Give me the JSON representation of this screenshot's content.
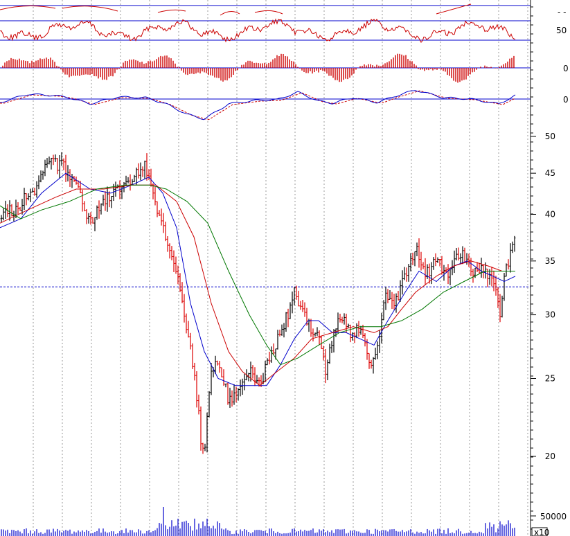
{
  "chart_data": {
    "type": "candlestick",
    "title": "",
    "xlabel": "",
    "ylabel": "",
    "price_axis": {
      "scale": "log",
      "ylim": [
        17.5,
        50.5
      ],
      "tick_labels": [
        "50",
        "45",
        "40",
        "35",
        "30",
        "25",
        "20"
      ],
      "reference_level": 32.5,
      "grid": "vertical dotted"
    },
    "price_path": [
      [
        0,
        39.5
      ],
      [
        10,
        40.5
      ],
      [
        25,
        40.5
      ],
      [
        35,
        42.0
      ],
      [
        55,
        43.5
      ],
      [
        70,
        46.5
      ],
      [
        90,
        46.0
      ],
      [
        110,
        43.5
      ],
      [
        130,
        39.0
      ],
      [
        150,
        41.5
      ],
      [
        170,
        43.0
      ],
      [
        190,
        44.5
      ],
      [
        210,
        46.0
      ],
      [
        225,
        41.0
      ],
      [
        240,
        37.0
      ],
      [
        255,
        34.0
      ],
      [
        265,
        30.5
      ],
      [
        275,
        27.0
      ],
      [
        285,
        23.5
      ],
      [
        292,
        20.0
      ],
      [
        297,
        21.0
      ],
      [
        305,
        25.5
      ],
      [
        315,
        26.5
      ],
      [
        330,
        23.5
      ],
      [
        345,
        24.0
      ],
      [
        360,
        25.5
      ],
      [
        375,
        24.5
      ],
      [
        390,
        26.5
      ],
      [
        405,
        28.5
      ],
      [
        415,
        30.0
      ],
      [
        425,
        32.0
      ],
      [
        432,
        31.0
      ],
      [
        445,
        29.0
      ],
      [
        460,
        28.5
      ],
      [
        470,
        25.5
      ],
      [
        480,
        28.0
      ],
      [
        490,
        30.0
      ],
      [
        505,
        28.5
      ],
      [
        520,
        29.0
      ],
      [
        535,
        25.5
      ],
      [
        545,
        27.0
      ],
      [
        555,
        32.0
      ],
      [
        570,
        31.0
      ],
      [
        585,
        33.5
      ],
      [
        600,
        36.5
      ],
      [
        615,
        33.5
      ],
      [
        630,
        35.5
      ],
      [
        645,
        33.5
      ],
      [
        660,
        35.5
      ],
      [
        670,
        35.5
      ],
      [
        685,
        34.0
      ],
      [
        700,
        34.0
      ],
      [
        712,
        33.0
      ],
      [
        722,
        30.0
      ],
      [
        730,
        34.0
      ],
      [
        738,
        36.0
      ],
      [
        744,
        37.5
      ]
    ],
    "moving_averages": [
      {
        "color": "#0000cc",
        "values": [
          [
            0,
            38.5
          ],
          [
            30,
            39.5
          ],
          [
            60,
            42.5
          ],
          [
            95,
            45.0
          ],
          [
            130,
            43.0
          ],
          [
            160,
            42.5
          ],
          [
            190,
            43.5
          ],
          [
            215,
            44.5
          ],
          [
            235,
            42.5
          ],
          [
            255,
            38.5
          ],
          [
            275,
            31.0
          ],
          [
            295,
            27.0
          ],
          [
            315,
            25.0
          ],
          [
            340,
            24.5
          ],
          [
            365,
            24.5
          ],
          [
            385,
            24.5
          ],
          [
            405,
            26.0
          ],
          [
            425,
            28.0
          ],
          [
            445,
            29.5
          ],
          [
            460,
            29.5
          ],
          [
            480,
            28.5
          ],
          [
            500,
            28.5
          ],
          [
            520,
            28.0
          ],
          [
            540,
            27.5
          ],
          [
            560,
            29.5
          ],
          [
            585,
            32.0
          ],
          [
            605,
            34.0
          ],
          [
            630,
            33.0
          ],
          [
            655,
            34.5
          ],
          [
            675,
            35.0
          ],
          [
            695,
            34.0
          ],
          [
            712,
            33.5
          ],
          [
            728,
            33.0
          ],
          [
            744,
            33.5
          ]
        ]
      },
      {
        "color": "#cc0000",
        "values": [
          [
            0,
            39.0
          ],
          [
            40,
            40.5
          ],
          [
            80,
            42.0
          ],
          [
            110,
            43.0
          ],
          [
            150,
            43.0
          ],
          [
            190,
            43.5
          ],
          [
            225,
            43.5
          ],
          [
            255,
            41.5
          ],
          [
            280,
            37.5
          ],
          [
            305,
            31.0
          ],
          [
            330,
            27.0
          ],
          [
            350,
            25.5
          ],
          [
            375,
            24.5
          ],
          [
            400,
            25.5
          ],
          [
            425,
            26.5
          ],
          [
            450,
            28.0
          ],
          [
            480,
            28.5
          ],
          [
            510,
            29.0
          ],
          [
            540,
            28.5
          ],
          [
            560,
            29.0
          ],
          [
            580,
            30.5
          ],
          [
            600,
            32.0
          ],
          [
            630,
            33.5
          ],
          [
            655,
            34.5
          ],
          [
            680,
            35.0
          ],
          [
            705,
            34.5
          ],
          [
            725,
            34.0
          ],
          [
            744,
            34.0
          ]
        ]
      },
      {
        "color": "#007700",
        "values": [
          [
            0,
            41.0
          ],
          [
            30,
            39.5
          ],
          [
            60,
            40.5
          ],
          [
            100,
            41.5
          ],
          [
            140,
            43.0
          ],
          [
            180,
            43.5
          ],
          [
            215,
            43.5
          ],
          [
            240,
            43.0
          ],
          [
            270,
            41.5
          ],
          [
            300,
            39.0
          ],
          [
            330,
            34.0
          ],
          [
            360,
            30.0
          ],
          [
            385,
            27.5
          ],
          [
            405,
            26.0
          ],
          [
            430,
            26.5
          ],
          [
            460,
            27.5
          ],
          [
            490,
            28.5
          ],
          [
            520,
            29.0
          ],
          [
            550,
            29.0
          ],
          [
            580,
            29.5
          ],
          [
            610,
            30.5
          ],
          [
            640,
            32.0
          ],
          [
            670,
            33.0
          ],
          [
            700,
            34.0
          ],
          [
            725,
            34.0
          ],
          [
            744,
            34.0
          ]
        ]
      }
    ],
    "volume": {
      "tick_label": "50000",
      "multiplier_label": "x10"
    },
    "indicator_panels": [
      {
        "axis_labels": [
          "- -",
          "50"
        ],
        "reference_lines": 3
      },
      {
        "type": "histogram",
        "axis_labels": [
          "0"
        ],
        "colors": [
          "#cc0000"
        ]
      },
      {
        "type": "line",
        "axis_labels": [
          "0"
        ],
        "series_colors": [
          "#0000cc",
          "#cc0000"
        ]
      }
    ]
  }
}
